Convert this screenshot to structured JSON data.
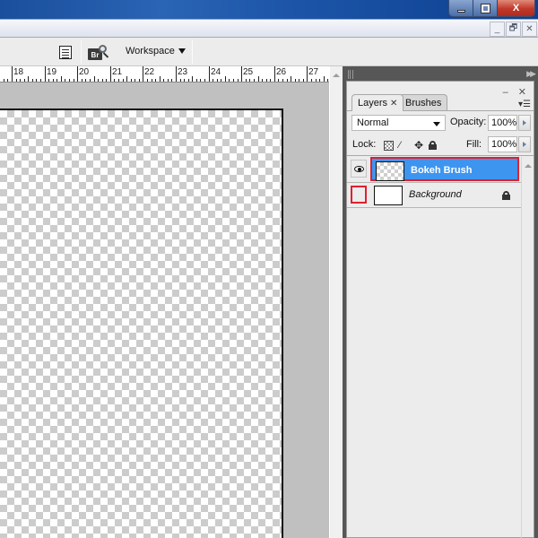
{
  "window": {
    "controls": {
      "minimize": "minimize",
      "maximize": "maximize",
      "close": "X"
    }
  },
  "document_controls": {
    "minimize": "_",
    "restore": "🗗",
    "close": "✕"
  },
  "options_bar": {
    "icons": [
      "document-list-icon",
      "bridge-browse-icon"
    ],
    "bridge_label": "Br",
    "workspace_label": "Workspace"
  },
  "ruler": {
    "labels": [
      "18",
      "19",
      "20",
      "21",
      "22",
      "23",
      "24",
      "25",
      "26",
      "27"
    ]
  },
  "dock": {
    "collapse_label": "▶▶"
  },
  "layers_panel": {
    "panel_controls": "– ✕",
    "menu_label": "▾☰",
    "tabs": [
      {
        "label": "Layers",
        "close": "✕",
        "active": true
      },
      {
        "label": "Brushes",
        "active": false
      }
    ],
    "blend_mode": "Normal",
    "opacity_label": "Opacity:",
    "opacity_value": "100%",
    "lock_label": "Lock:",
    "lock_icons": [
      "lock-transparency-icon",
      "lock-image-icon",
      "lock-position-icon",
      "lock-all-icon"
    ],
    "fill_label": "Fill:",
    "fill_value": "100%",
    "layers": [
      {
        "name": "Bokeh Brush",
        "visible": true,
        "selected": true,
        "thumbnail": "transparent",
        "highlighted": true
      },
      {
        "name": "Background",
        "visible": false,
        "selected": false,
        "thumbnail": "white",
        "locked": true,
        "visibility_highlighted": true
      }
    ]
  },
  "colors": {
    "selection_blue": "#3d95f0",
    "highlight_red": "#e0202e",
    "dock_dark": "#575757",
    "panel_bg": "#ececec",
    "workspace_gray": "#c0c0c0"
  }
}
